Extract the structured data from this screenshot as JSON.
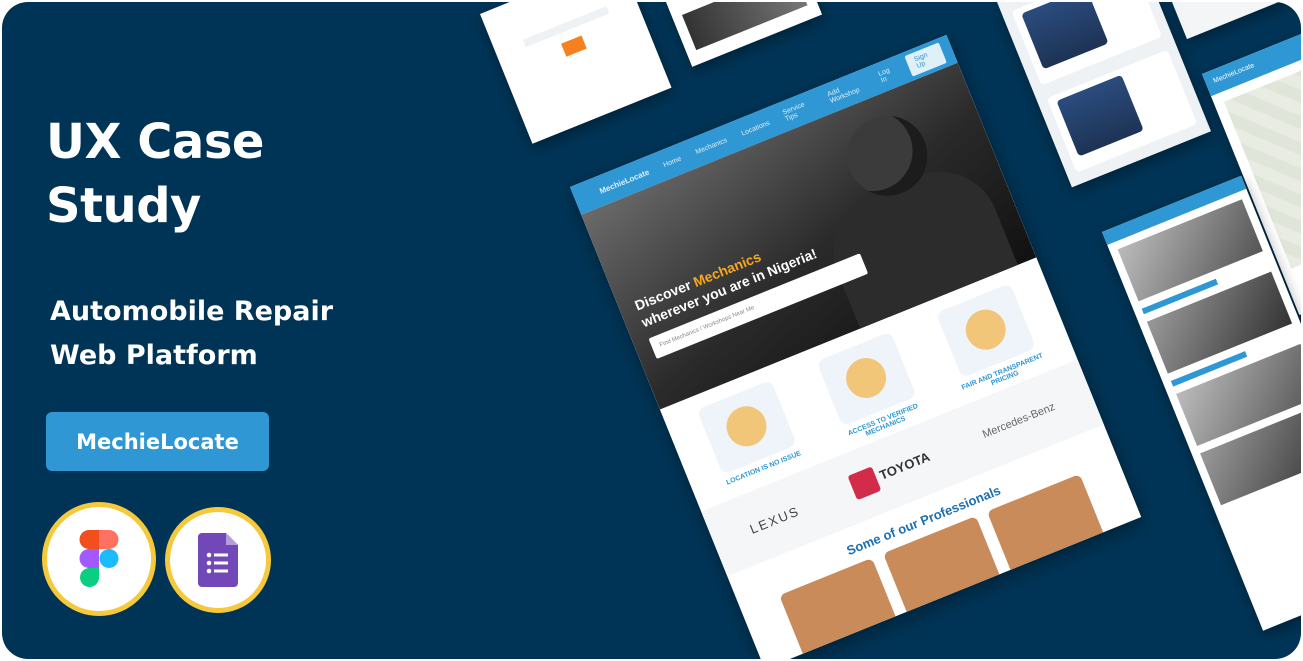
{
  "hero": {
    "title_line1": "UX Case",
    "title_line2": "Study",
    "subtitle_line1": "Automobile Repair",
    "subtitle_line2": "Web Platform",
    "cta_label": "MechieLocate"
  },
  "tools": [
    "figma-icon",
    "google-forms-icon"
  ],
  "mockup": {
    "logo": "MechieLocate",
    "nav": [
      "Home",
      "Mechanics",
      "Locations",
      "Service Tips",
      "Add Workshop",
      "Log In"
    ],
    "signup": "Sign Up",
    "hero_line1": "Discover ",
    "hero_highlight": "Mechanics",
    "hero_line2": "wherever you are in Nigeria!",
    "search_placeholder": "Find Mechanics / Workshops Near Me",
    "features": [
      {
        "caption": "LOCATION IS NO ISSUE"
      },
      {
        "caption": "ACCESS TO VERIFIED MECHANICS"
      },
      {
        "caption": "FAIR AND TRANSPARENT PRICING"
      }
    ],
    "brands": [
      "LEXUS",
      "TOYOTA",
      "Mercedes-Benz"
    ],
    "pros_heading": "Some of our Professionals"
  },
  "colors": {
    "background": "#003456",
    "accent": "#2f97d4",
    "tool_ring": "#f5c93b",
    "highlight": "#f5a623"
  }
}
